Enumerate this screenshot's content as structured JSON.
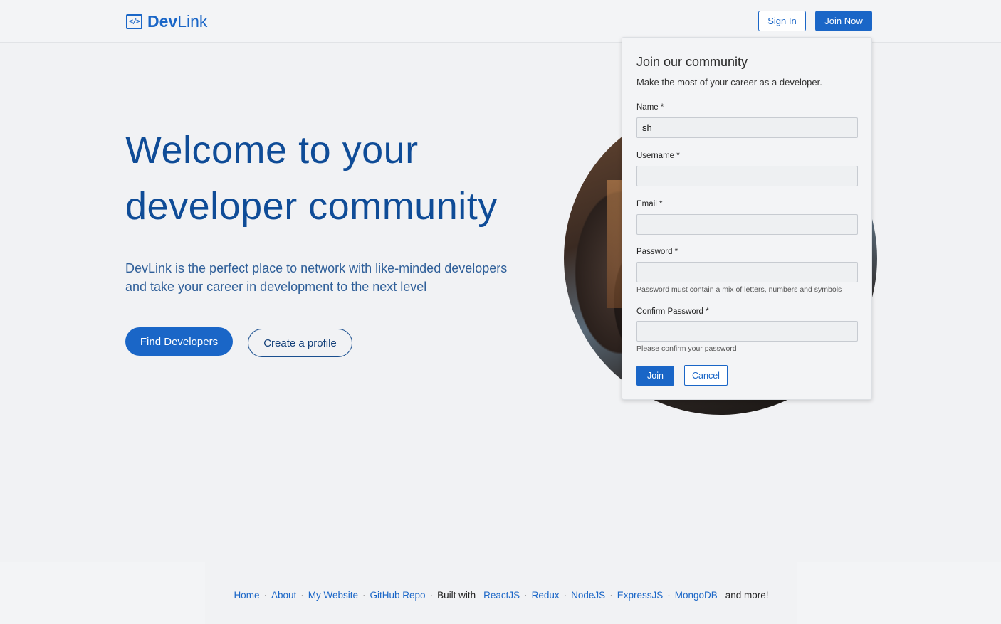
{
  "header": {
    "logo_icon": "</>",
    "logo_strong": "Dev",
    "logo_light": "Link",
    "sign_in": "Sign In",
    "join_now": "Join Now"
  },
  "hero": {
    "title": "Welcome to your developer community",
    "subtitle": "DevLink is the perfect place to network with like-minded developers and take your career in development to the next level",
    "find_button": "Find Developers",
    "create_button": "Create a profile"
  },
  "modal": {
    "title": "Join our community",
    "subtitle": "Make the most of your career as a developer.",
    "name_label": "Name *",
    "name_value": "sh",
    "username_label": "Username *",
    "email_label": "Email *",
    "password_label": "Password *",
    "password_hint": "Password must contain a mix of letters, numbers and symbols",
    "confirm_label": "Confirm Password *",
    "confirm_hint": "Please confirm your password",
    "join_button": "Join",
    "cancel_button": "Cancel"
  },
  "footer": {
    "home": "Home",
    "about": "About",
    "website": "My Website",
    "repo": "GitHub Repo",
    "built_with": "Built with",
    "tech": [
      "ReactJS",
      "Redux",
      "NodeJS",
      "ExpressJS",
      "MongoDB"
    ],
    "and_more": "and more!",
    "separator": "·"
  },
  "colors": {
    "accent": "#1a66c7",
    "heading": "#0f4c97",
    "background": "#f1f2f4"
  }
}
